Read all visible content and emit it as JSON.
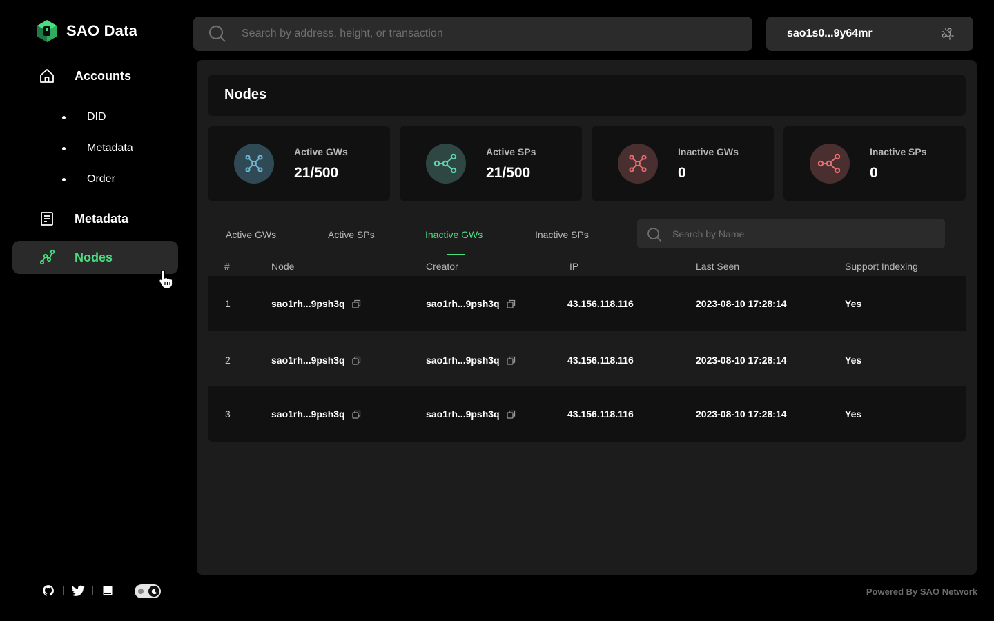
{
  "brand": {
    "name": "SAO Data",
    "accent": "#4ade80"
  },
  "search": {
    "placeholder": "Search by address, height, or transaction"
  },
  "wallet": {
    "address": "sao1s0...9y64mr"
  },
  "sidebar": {
    "items": [
      {
        "label": "Accounts",
        "icon": "home-icon"
      },
      {
        "label": "Metadata",
        "icon": "document-icon"
      },
      {
        "label": "Nodes",
        "icon": "nodes-graph-icon",
        "active": true
      }
    ],
    "subitems": [
      {
        "label": "DID"
      },
      {
        "label": "Metadata"
      },
      {
        "label": "Order"
      }
    ]
  },
  "page": {
    "title": "Nodes"
  },
  "stats": [
    {
      "label": "Active GWs",
      "value": "21/500",
      "color": "#6fb8d6",
      "icon": "gateway-icon"
    },
    {
      "label": "Active SPs",
      "value": "21/500",
      "color": "#5fd6b0",
      "icon": "share-nodes-icon"
    },
    {
      "label": "Inactive GWs",
      "value": "0",
      "color": "#e86f6f",
      "icon": "gateway-icon"
    },
    {
      "label": "Inactive SPs",
      "value": "0",
      "color": "#e86f6f",
      "icon": "share-nodes-icon"
    }
  ],
  "tabs": [
    {
      "label": "Active GWs"
    },
    {
      "label": "Active SPs"
    },
    {
      "label": "Inactive GWs",
      "active": true
    },
    {
      "label": "Inactive SPs"
    }
  ],
  "table": {
    "search_placeholder": "Search by Name",
    "headers": [
      "#",
      "Node",
      "Creator",
      "IP",
      "Last Seen",
      "Support Indexing"
    ],
    "rows": [
      {
        "index": "1",
        "node": "sao1rh...9psh3q",
        "creator": "sao1rh...9psh3q",
        "ip": "43.156.118.116",
        "last_seen": "2023-08-10 17:28:14",
        "indexing": "Yes"
      },
      {
        "index": "2",
        "node": "sao1rh...9psh3q",
        "creator": "sao1rh...9psh3q",
        "ip": "43.156.118.116",
        "last_seen": "2023-08-10 17:28:14",
        "indexing": "Yes"
      },
      {
        "index": "3",
        "node": "sao1rh...9psh3q",
        "creator": "sao1rh...9psh3q",
        "ip": "43.156.118.116",
        "last_seen": "2023-08-10 17:28:14",
        "indexing": "Yes"
      }
    ]
  },
  "footer": {
    "powered_by": "Powered By SAO Network",
    "icons": [
      "github-icon",
      "twitter-icon",
      "book-icon"
    ]
  }
}
